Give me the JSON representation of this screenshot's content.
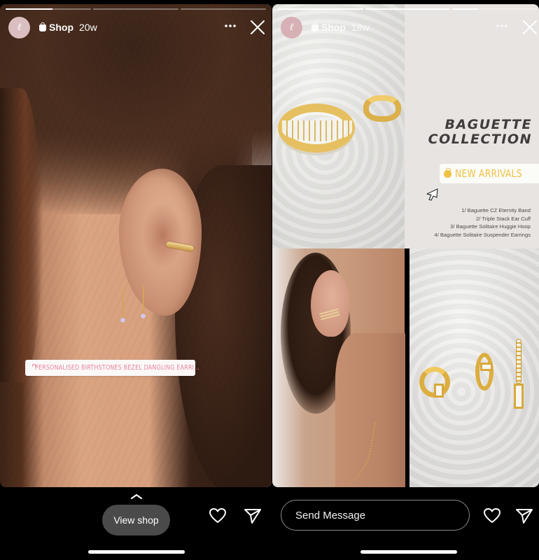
{
  "stories": [
    {
      "account": {
        "avatar_glyph": "ℓ",
        "label": "Shop",
        "time": "20w"
      },
      "progress": [
        0.55,
        0,
        0
      ],
      "product_sticker": {
        "label": "PERSONALISED BIRTHSTONES BEZEL DANGLING EARRI..."
      },
      "footer": {
        "expand_hint": "swipe-up",
        "view_shop_label": "View shop"
      }
    },
    {
      "account": {
        "avatar_glyph": "ℓ",
        "label": "Shop",
        "time": "18w"
      },
      "progress": [
        1,
        1,
        0.3
      ],
      "collage": {
        "title_line1": "BAGUETTE",
        "title_line2": "COLLECTION",
        "badge_label": "NEW ARRIVALS",
        "products": [
          "1/ Baguette CZ Eternity Band",
          "2/ Triple Stack Ear Cuff",
          "3/ Baguette Solitaire Huggie Hoop",
          "4/  Baguette Solitaire Suspender Earrings"
        ]
      },
      "footer": {
        "message_placeholder": "Send Message"
      }
    }
  ],
  "icons": {
    "more": "more-horizontal-icon",
    "close": "close-icon",
    "like": "heart-icon",
    "share": "send-paper-plane-icon",
    "shop": "shopping-bag-icon"
  },
  "colors": {
    "sticker_text": "#e5879e",
    "badge_text": "#f0c244",
    "view_shop_bg": "#4a4a4a",
    "background": "#000000"
  }
}
